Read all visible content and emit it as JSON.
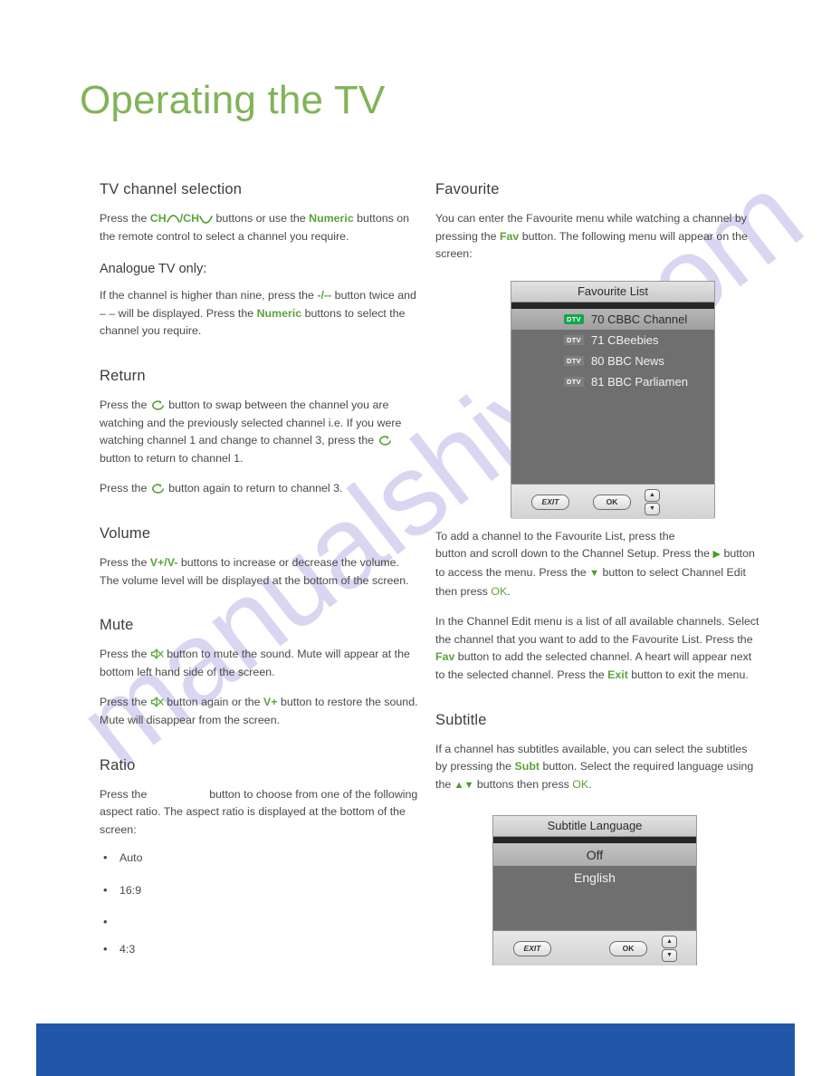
{
  "page": {
    "title": "Operating the TV",
    "title_color": "#81b358",
    "accent_green": "#5aa43c",
    "bottom_bar_color": "#2256a8",
    "watermark_text": "manualshive.com"
  },
  "left_column": {
    "tv_channel_selection": {
      "heading": "TV channel selection",
      "p1_a": "Press the ",
      "p1_ch_up": "CH",
      "p1_slash": "/CH",
      "p1_b": " buttons or use the ",
      "p1_numeric": "Numeric",
      "p1_c": " buttons on the remote control to select a channel you require.",
      "subheading": "Analogue TV only:",
      "p2_a": "If the channel is higher than nine, press the ",
      "p2_minus": "-/--",
      "p2_b": " button twice and ",
      "p2_dashes": "– –",
      "p2_c": " will be displayed. Press the ",
      "p2_numeric": "Numeric",
      "p2_d": " buttons to select the channel you require."
    },
    "return": {
      "heading": "Return",
      "p1_a": "Press the ",
      "p1_b": " button to swap between the channel you are watching and the previously selected channel i.e. If you were watching channel 1 and change to channel 3, press the ",
      "p1_c": " button to return to channel 1.",
      "p2_a": "Press the ",
      "p2_b": " button again to return to channel 3."
    },
    "volume": {
      "heading": "Volume",
      "p1_a": "Press the ",
      "p1_keys": "V+/V-",
      "p1_b": " buttons to increase or decrease the volume. The volume level will be displayed at the bottom of the screen."
    },
    "mute": {
      "heading": "Mute",
      "p1_a": "Press the ",
      "p1_b": " button to mute the sound. Mute will appear at the bottom left hand side of the screen.",
      "p2_a": "Press the ",
      "p2_b": " button again or the ",
      "p2_key": "V+",
      "p2_c": " button to restore the sound. Mute will disappear from the screen."
    },
    "ratio": {
      "heading": "Ratio",
      "p1_a": "Press the ",
      "p1_b": " button to choose from one of the following aspect ratio. The aspect ratio is displayed at the bottom of the screen:",
      "options": [
        "Auto",
        "16:9",
        "",
        "4:3"
      ]
    }
  },
  "right_column": {
    "favourite": {
      "heading": "Favourite",
      "p1_a": "You can enter the Favourite menu while watching a channel by pressing the ",
      "p1_fav": "Fav",
      "p1_b": " button. The following menu will appear on the screen:",
      "p2_a": "To add a channel to the Favourite List, press the ",
      "p2_b": " button and scroll down to the Channel Setup. Press the ",
      "p2_c": " button to access the menu. Press the ",
      "p2_d": " button to select Channel Edit then press ",
      "p2_ok": "OK",
      "p2_e": ".",
      "p3_a": "In the Channel Edit menu is a list of all available channels. Select the channel that you want to add to the Favourite List. Press the ",
      "p3_fav": "Fav",
      "p3_b": " button to add the selected channel. A heart will appear next to the selected channel. Press the ",
      "p3_exit": "Exit",
      "p3_c": " button to exit the menu."
    },
    "subtitle": {
      "heading": "Subtitle",
      "p1_a": "If a channel has subtitles available, you can select the subtitles by pressing the ",
      "p1_subt": "Subt",
      "p1_b": " button. Select the required language using the ",
      "p1_c": " buttons then press ",
      "p1_ok": "OK",
      "p1_d": "."
    }
  },
  "osd_favourite": {
    "title": "Favourite List",
    "rows": [
      {
        "badge": "DTV",
        "label": "70 CBBC Channel",
        "selected": true
      },
      {
        "badge": "DTV",
        "label": "71 CBeebies",
        "selected": false
      },
      {
        "badge": "DTV",
        "label": "80 BBC News",
        "selected": false
      },
      {
        "badge": "DTV",
        "label": "81 BBC Parliamen",
        "selected": false
      }
    ],
    "exit_label": "EXIT",
    "ok_label": "OK",
    "up_glyph": "▲",
    "down_glyph": "▼"
  },
  "osd_subtitle": {
    "title": "Subtitle Language",
    "rows": [
      {
        "label": "Off",
        "selected": true
      },
      {
        "label": "English",
        "selected": false
      }
    ],
    "exit_label": "EXIT",
    "ok_label": "OK",
    "up_glyph": "▲",
    "down_glyph": "▼"
  }
}
